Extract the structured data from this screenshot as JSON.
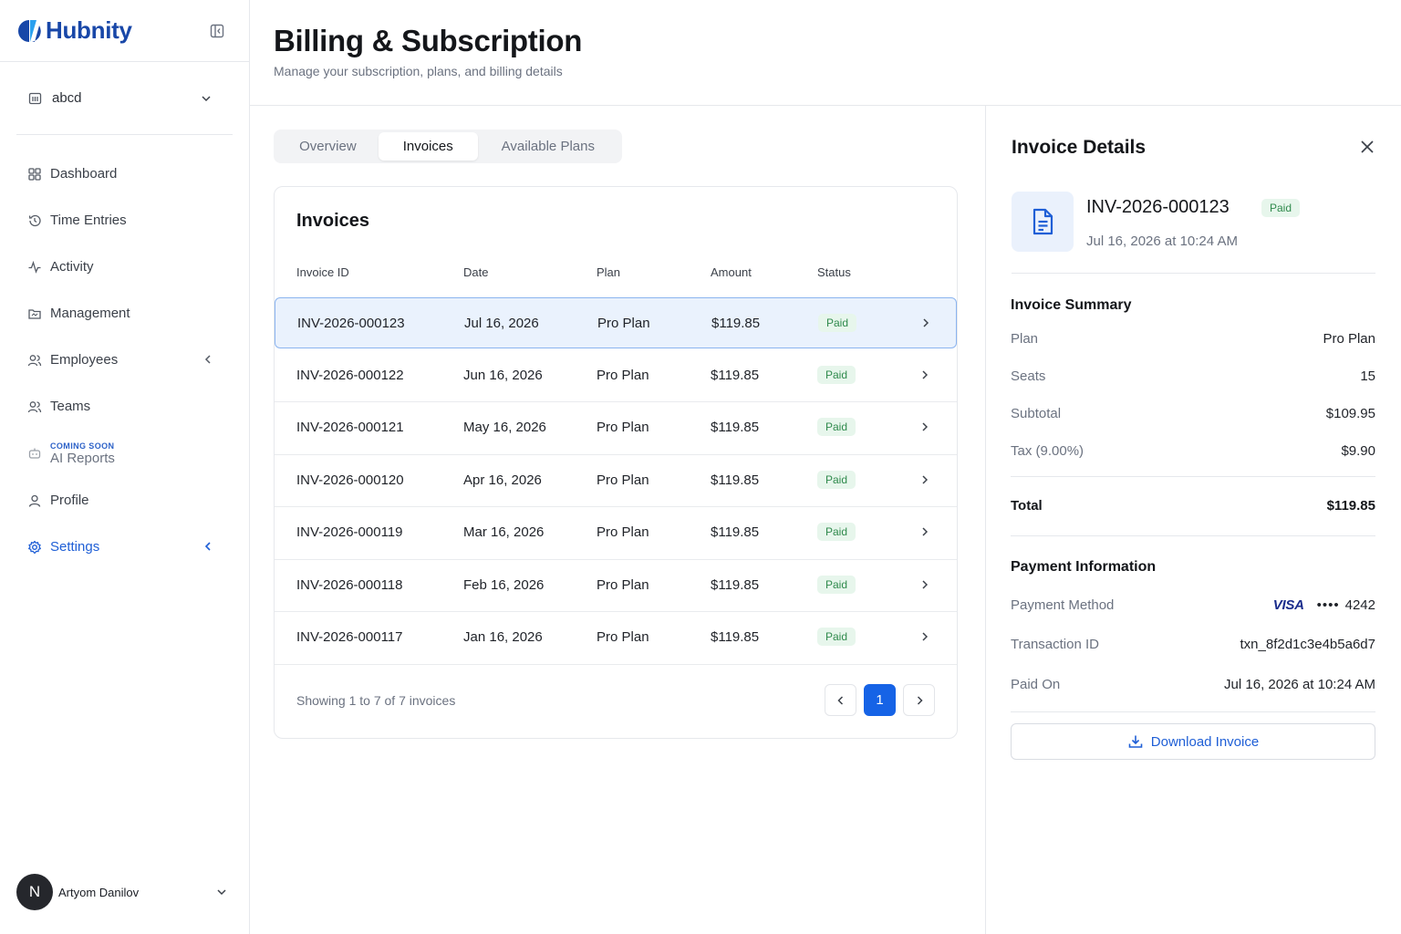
{
  "app": {
    "name": "Hubnity"
  },
  "sidebar": {
    "org": "abcd",
    "items": [
      {
        "label": "Dashboard"
      },
      {
        "label": "Time Entries"
      },
      {
        "label": "Activity"
      },
      {
        "label": "Management"
      },
      {
        "label": "Employees"
      },
      {
        "label": "Teams"
      },
      {
        "label": "AI Reports",
        "tag": "COMING SOON"
      },
      {
        "label": "Profile"
      },
      {
        "label": "Settings"
      }
    ],
    "user": {
      "initial": "N",
      "name": "Artyom Danilov"
    }
  },
  "header": {
    "title": "Billing & Subscription",
    "subtitle": "Manage your subscription, plans, and billing details"
  },
  "tabs": [
    "Overview",
    "Invoices",
    "Available Plans"
  ],
  "invoices": {
    "title": "Invoices",
    "columns": [
      "Invoice ID",
      "Date",
      "Plan",
      "Amount",
      "Status"
    ],
    "rows": [
      {
        "id": "INV-2026-000123",
        "date": "Jul 16, 2026",
        "plan": "Pro Plan",
        "amount": "$119.85",
        "status": "Paid"
      },
      {
        "id": "INV-2026-000122",
        "date": "Jun 16, 2026",
        "plan": "Pro Plan",
        "amount": "$119.85",
        "status": "Paid"
      },
      {
        "id": "INV-2026-000121",
        "date": "May 16, 2026",
        "plan": "Pro Plan",
        "amount": "$119.85",
        "status": "Paid"
      },
      {
        "id": "INV-2026-000120",
        "date": "Apr 16, 2026",
        "plan": "Pro Plan",
        "amount": "$119.85",
        "status": "Paid"
      },
      {
        "id": "INV-2026-000119",
        "date": "Mar 16, 2026",
        "plan": "Pro Plan",
        "amount": "$119.85",
        "status": "Paid"
      },
      {
        "id": "INV-2026-000118",
        "date": "Feb 16, 2026",
        "plan": "Pro Plan",
        "amount": "$119.85",
        "status": "Paid"
      },
      {
        "id": "INV-2026-000117",
        "date": "Jan 16, 2026",
        "plan": "Pro Plan",
        "amount": "$119.85",
        "status": "Paid"
      }
    ],
    "showing": "Showing 1 to 7 of 7 invoices",
    "current_page": "1"
  },
  "details": {
    "title": "Invoice Details",
    "invoice_id": "INV-2026-000123",
    "status": "Paid",
    "datetime": "Jul 16, 2026 at 10:24 AM",
    "summary_title": "Invoice Summary",
    "summary": [
      {
        "label": "Plan",
        "value": "Pro Plan"
      },
      {
        "label": "Seats",
        "value": "15"
      },
      {
        "label": "Subtotal",
        "value": "$109.95"
      },
      {
        "label": "Tax (9.00%)",
        "value": "$9.90"
      }
    ],
    "total_label": "Total",
    "total_value": "$119.85",
    "payment_title": "Payment Information",
    "payment_method_label": "Payment Method",
    "card_brand": "VISA",
    "card_dots": "••••",
    "card_last4": "4242",
    "transaction_label": "Transaction ID",
    "transaction_id": "txn_8f2d1c3e4b5a6d7",
    "paid_on_label": "Paid On",
    "paid_on": "Jul 16, 2026 at 10:24 AM",
    "download_label": "Download Invoice"
  },
  "colors": {
    "accent": "#1663e6",
    "paid_bg": "#e7f6ec",
    "paid_text": "#2f8a4c",
    "brand": "#1847a8"
  }
}
